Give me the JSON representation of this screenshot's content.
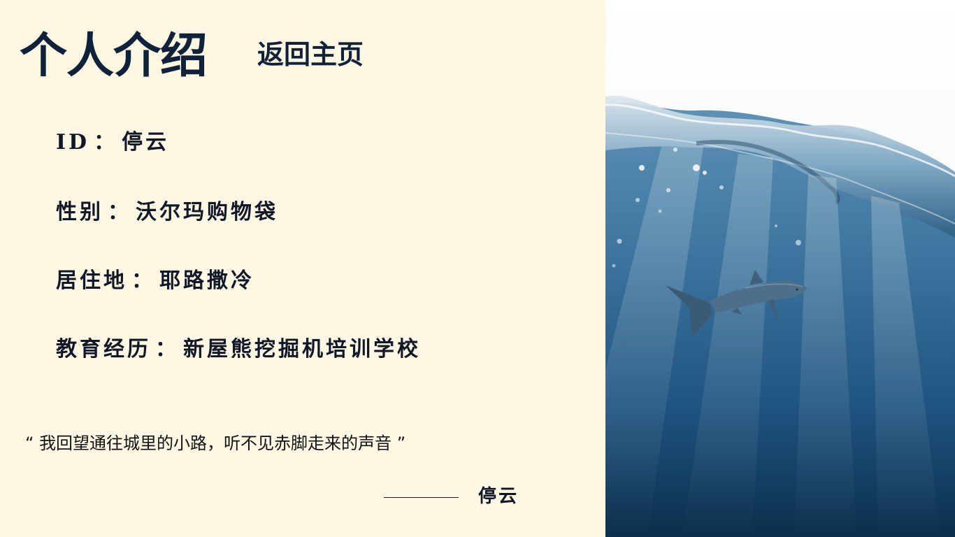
{
  "header": {
    "title": "个人介绍",
    "home_link": "返回主页"
  },
  "profile": {
    "separator": "：",
    "fields": [
      {
        "label": "ID",
        "value": "停云"
      },
      {
        "label": "性别",
        "value": "沃尔玛购物袋"
      },
      {
        "label": "居住地",
        "value": "耶路撒冷"
      },
      {
        "label": "教育经历",
        "value": "新屋熊挖掘机培训学校"
      }
    ]
  },
  "quote": {
    "text": "“ 我回望通往城里的小路，听不见赤脚走来的声音 ”",
    "author": "停云"
  },
  "colors": {
    "background": "#fdf7e3",
    "text_dark": "#0f2239",
    "ocean_deep": "#0d3453",
    "ocean_light": "#5a8fb5",
    "sky": "#f7f8f8"
  },
  "image": {
    "icon": "shark-underwater-photo"
  }
}
